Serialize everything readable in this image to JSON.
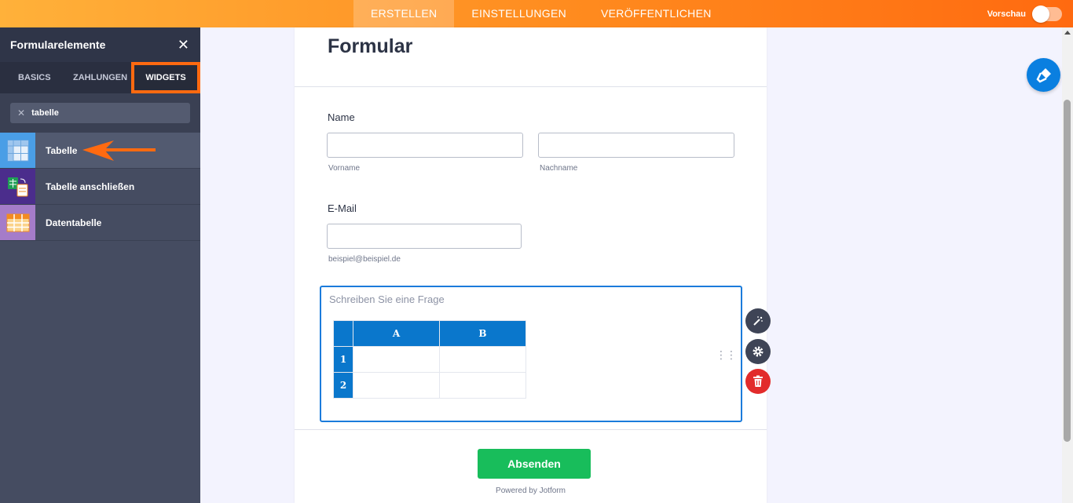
{
  "topbar": {
    "tabs": [
      {
        "label": "ERSTELLEN",
        "active": true
      },
      {
        "label": "EINSTELLUNGEN",
        "active": false
      },
      {
        "label": "VERÖFFENTLICHEN",
        "active": false
      }
    ],
    "preview_label": "Vorschau",
    "accent_color": "#ff8a1e"
  },
  "sidebar": {
    "title": "Formularelemente",
    "tabs": [
      "BASICS",
      "ZAHLUNGEN",
      "WIDGETS"
    ],
    "active_tab": "WIDGETS",
    "search_value": "tabelle",
    "items": [
      {
        "label": "Tabelle",
        "icon": "table-grid-icon",
        "active": true
      },
      {
        "label": "Tabelle anschließen",
        "icon": "spreadsheet-connect-icon",
        "active": false
      },
      {
        "label": "Datentabelle",
        "icon": "data-table-icon",
        "active": false
      }
    ]
  },
  "form": {
    "title": "Formular",
    "name_label": "Name",
    "first_name_sublabel": "Vorname",
    "last_name_sublabel": "Nachname",
    "email_label": "E-Mail",
    "email_sublabel": "beispiel@beispiel.de",
    "question_placeholder": "Schreiben Sie eine Frage",
    "matrix": {
      "columns": [
        "A",
        "B"
      ],
      "rows": [
        "1",
        "2"
      ]
    },
    "submit_label": "Absenden",
    "powered_by": "Powered by Jotform"
  }
}
